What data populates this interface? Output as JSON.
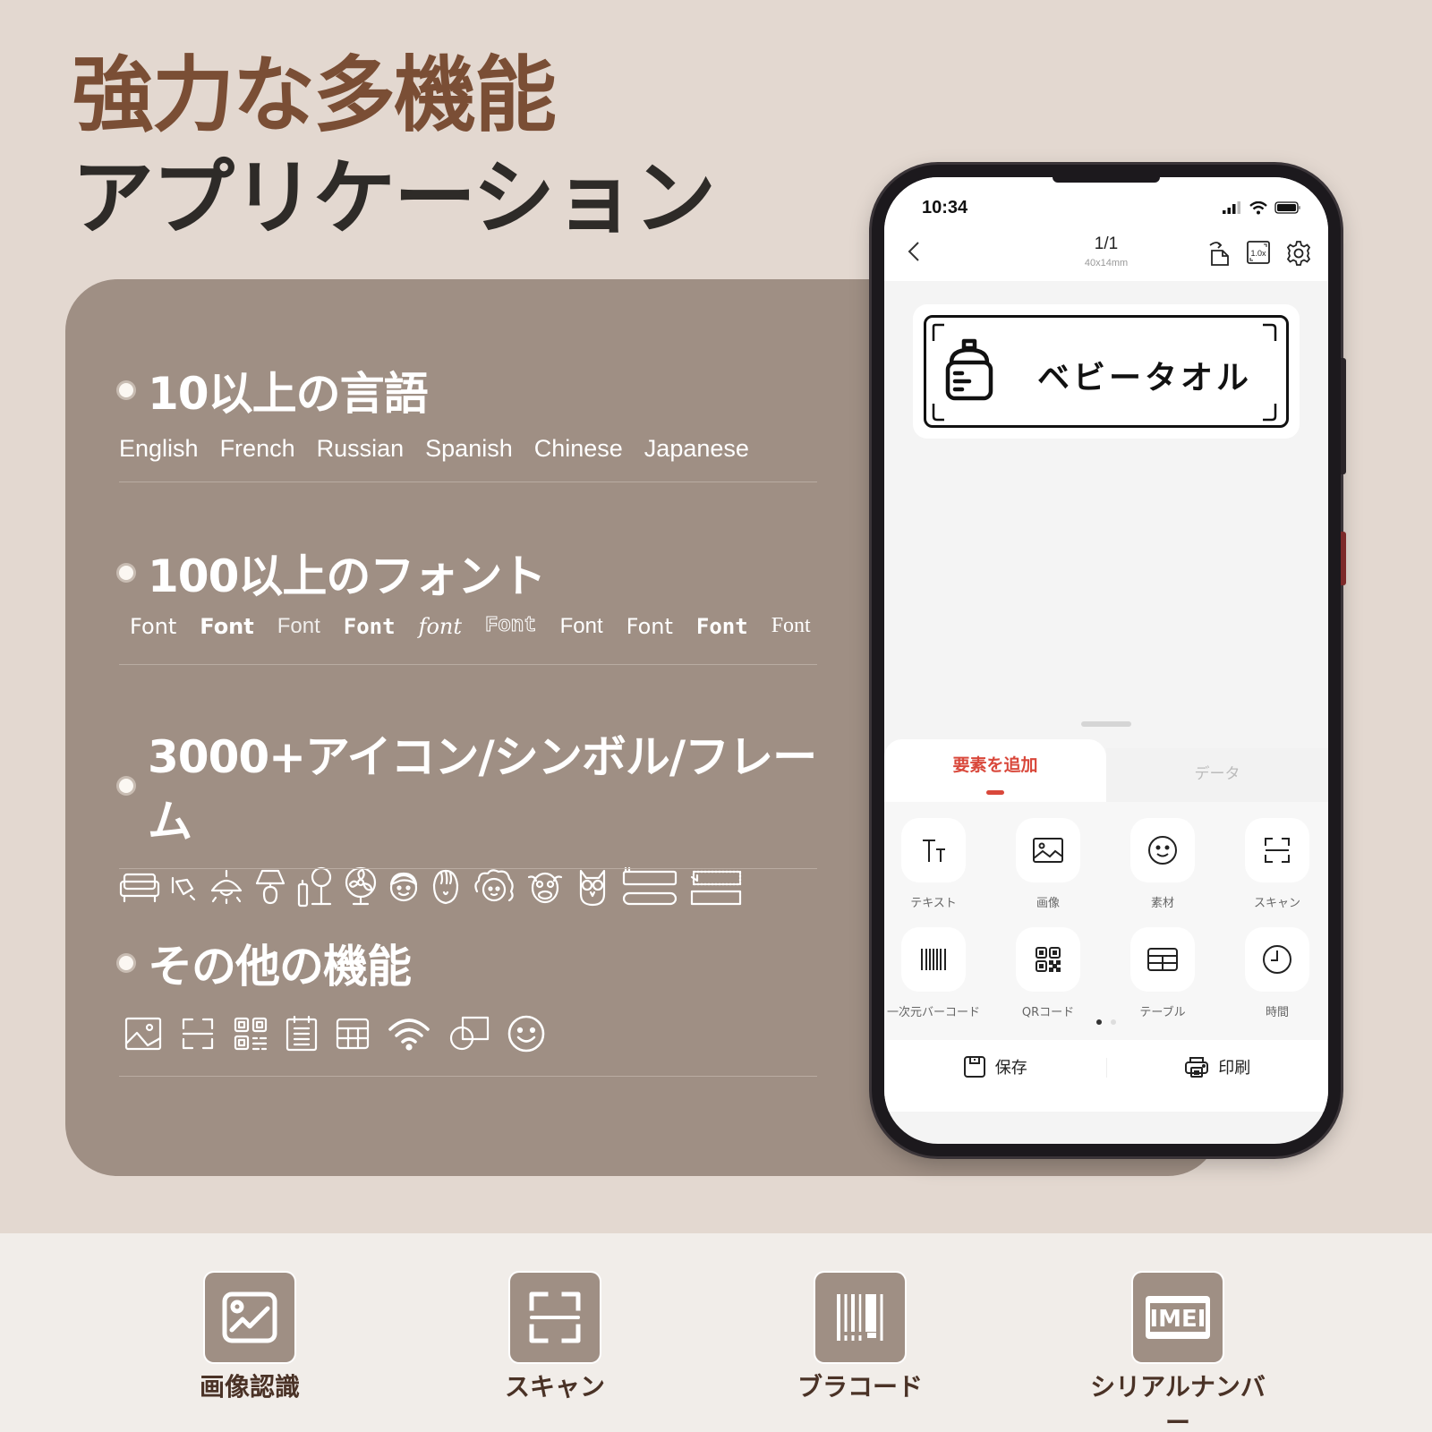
{
  "headline": {
    "line1": "強力な多機能",
    "line2": "アプリケーション"
  },
  "features": [
    {
      "title": "10以上の言語",
      "languages": [
        "English",
        "French",
        "Russian",
        "Spanish",
        "Chinese",
        "Japanese"
      ]
    },
    {
      "title": "100以上のフォント",
      "font_samples": [
        "Font",
        "Font",
        "Font",
        "Font",
        "font",
        "Font",
        "Font",
        "Font",
        "Font",
        "Font"
      ]
    },
    {
      "title": "3000+アイコン/シンボル/フレーム",
      "icons": [
        "sofa-icon",
        "light-bulb-icon",
        "pendant-lamp-icon",
        "table-lamp-icon",
        "floor-lamp-icon",
        "fan-icon",
        "boy-face-icon",
        "man-face-icon",
        "curly-hair-face-icon",
        "cow-face-icon",
        "owl-icon",
        "frame-banner-icon",
        "frame-label-icon"
      ]
    },
    {
      "title": "その他の機能",
      "icons": [
        "image-icon",
        "scan-icon",
        "qr-code-icon",
        "notepad-icon",
        "table-icon",
        "wifi-icon",
        "shapes-icon",
        "smiley-icon"
      ]
    }
  ],
  "phone": {
    "status": {
      "time": "10:34"
    },
    "nav": {
      "page": "1/1",
      "size": "40x14mm",
      "zoom": "1.0x"
    },
    "label": {
      "text": "ベビータオル",
      "icon": "baby-bottle-icon"
    },
    "tabs": {
      "active": "要素を追加",
      "inactive": "データ"
    },
    "tools": [
      {
        "label": "テキスト",
        "icon": "text-icon"
      },
      {
        "label": "画像",
        "icon": "image-icon"
      },
      {
        "label": "素材",
        "icon": "smiley-icon"
      },
      {
        "label": "スキャン",
        "icon": "scan-icon"
      },
      {
        "label": "一次元バーコード",
        "icon": "barcode-icon"
      },
      {
        "label": "QRコード",
        "icon": "qr-code-icon"
      },
      {
        "label": "テーブル",
        "icon": "table-icon"
      },
      {
        "label": "時間",
        "icon": "clock-icon"
      }
    ],
    "page_indicator": {
      "current": 1,
      "total": 2
    },
    "bottom": {
      "save": "保存",
      "print": "印刷"
    }
  },
  "bottom_features": [
    {
      "label": "画像認識",
      "icon": "image-recognition-icon"
    },
    {
      "label": "スキャン",
      "icon": "scan-icon"
    },
    {
      "label": "ブラコード",
      "icon": "barcode-icon"
    },
    {
      "label": "シリアルナンバー",
      "icon": "imei-icon"
    }
  ],
  "colors": {
    "background": "#e3d8d0",
    "panel": "#9f8f84",
    "headline_accent": "#7a4e35",
    "headline_dark": "#2e2b28",
    "app_accent": "#d9483b",
    "band": "#f1ede9"
  }
}
